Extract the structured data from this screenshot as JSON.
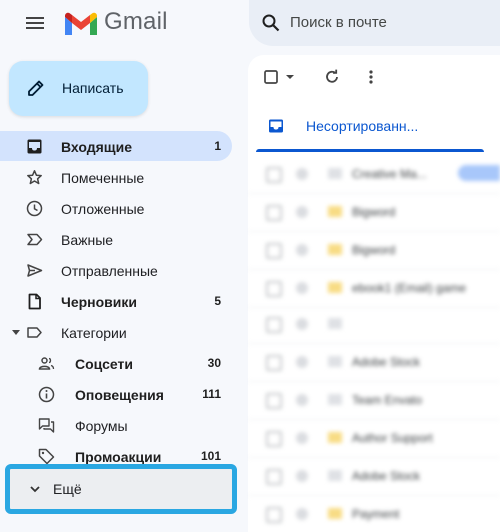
{
  "app": {
    "name": "Gmail"
  },
  "colors": {
    "accent": "#0b57d0",
    "compose_bg": "#c2e7ff",
    "active_bg": "#d3e3fd",
    "highlight_border": "#2aa7e2"
  },
  "icons": {
    "menu": "hamburger-icon",
    "compose": "pencil-icon",
    "search": "search-icon",
    "inbox": "inbox-icon",
    "starred": "star-icon",
    "snoozed": "clock-icon",
    "important": "label-important-icon",
    "sent": "send-icon",
    "drafts": "draft-icon",
    "categories": "label-icon",
    "social": "people-icon",
    "updates": "info-icon",
    "forums": "forum-icon",
    "promotions": "tag-icon",
    "more": "chevron-down-icon"
  },
  "compose": {
    "label": "Написать"
  },
  "search": {
    "placeholder": "Поиск в почте"
  },
  "nav": {
    "inbox": {
      "label": "Входящие",
      "count": "1"
    },
    "starred": {
      "label": "Помеченные"
    },
    "snoozed": {
      "label": "Отложенные"
    },
    "important": {
      "label": "Важные"
    },
    "sent": {
      "label": "Отправленные"
    },
    "drafts": {
      "label": "Черновики",
      "count": "5"
    },
    "categories": {
      "label": "Категории"
    },
    "social": {
      "label": "Соцсети",
      "count": "30"
    },
    "updates": {
      "label": "Оповещения",
      "count": "111"
    },
    "forums": {
      "label": "Форумы"
    },
    "promotions": {
      "label": "Промоакции",
      "count": "101"
    },
    "more": {
      "label": "Ещё"
    }
  },
  "main": {
    "tabs": [
      {
        "label": "Несортированн..."
      }
    ],
    "messages": [
      {
        "sender": "Creative Ma...",
        "important": false,
        "tag": true
      },
      {
        "sender": "Bigword",
        "important": true,
        "tag": false
      },
      {
        "sender": "Bigword",
        "important": true,
        "tag": false
      },
      {
        "sender": "ebook1 (Email) game",
        "important": true,
        "tag": false
      },
      {
        "sender": "",
        "important": false,
        "tag": false
      },
      {
        "sender": "Adobe Stock",
        "important": false,
        "tag": false
      },
      {
        "sender": "Team Envato",
        "important": false,
        "tag": false
      },
      {
        "sender": "Author Support",
        "important": true,
        "tag": false
      },
      {
        "sender": "Adobe Stock",
        "important": false,
        "tag": false
      },
      {
        "sender": "Payment",
        "important": true,
        "tag": false
      }
    ]
  }
}
